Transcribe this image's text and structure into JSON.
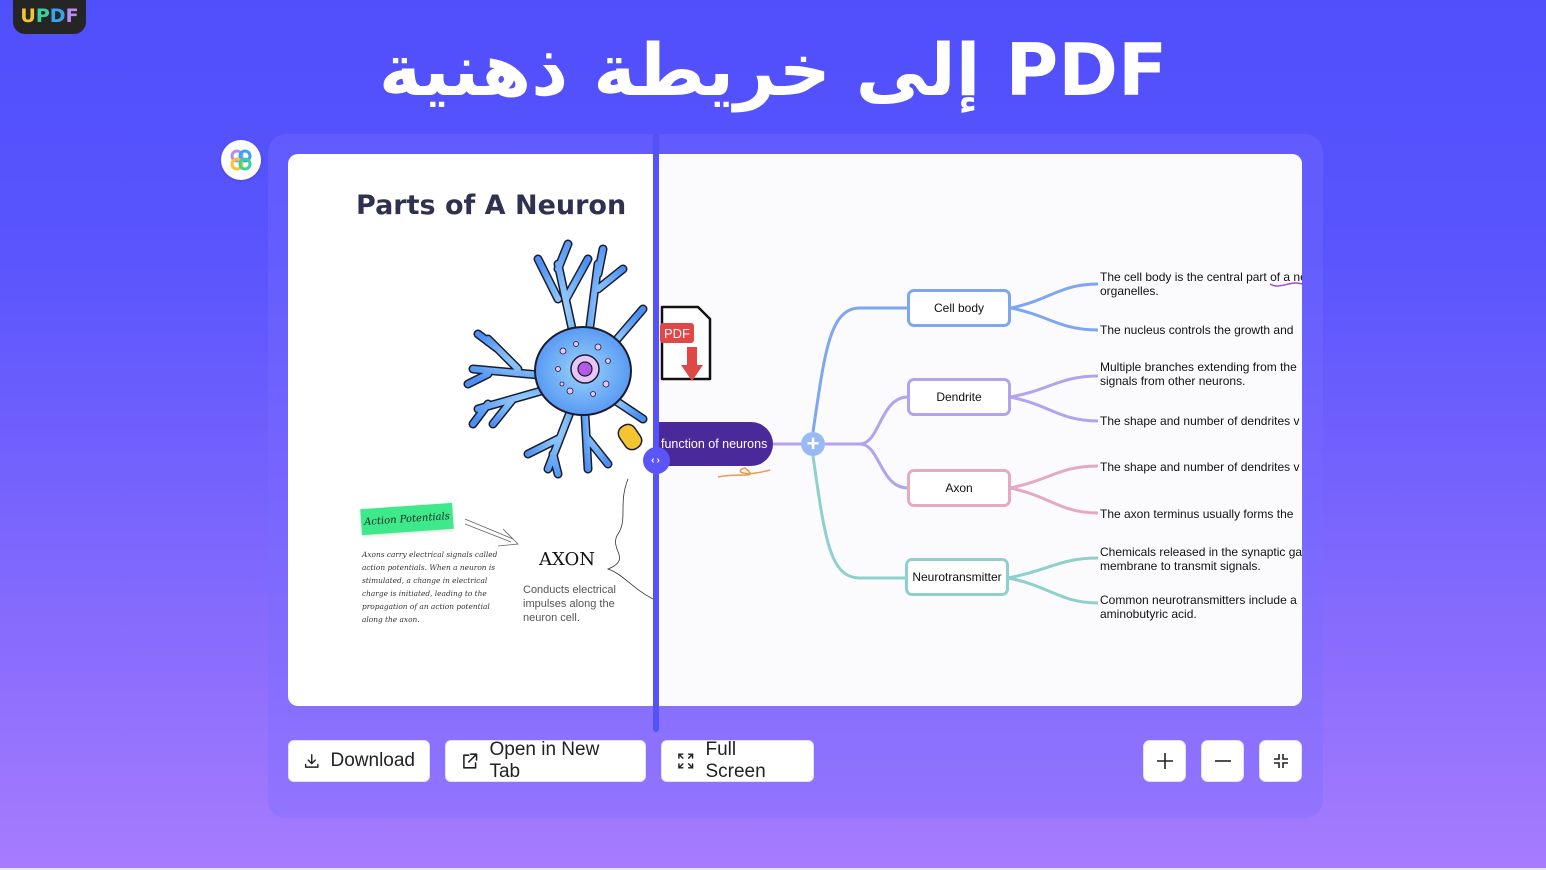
{
  "logo": {
    "letters": [
      "U",
      "P",
      "D",
      "F"
    ],
    "colors": [
      "#f4c431",
      "#36d39a",
      "#3aa3f0",
      "#b98cf6"
    ]
  },
  "hero": {
    "title": "PDF إلى خريطة ذهنية"
  },
  "badge": {
    "icon": "updf-ai-flower-icon"
  },
  "document": {
    "title": "Parts of A Neuron",
    "tag": "Action Potentials",
    "tag_color": "#3ee98b",
    "action_text": "Axons carry electrical signals called action potentials. When a neuron is stimulated, a change in electrical charge is initiated, leading to the propagation of an action potential along the axon.",
    "axon_title": "AXON",
    "axon_desc": "Conducts electrical impulses along the neuron cell."
  },
  "pdf_icon": {
    "label": "PDF",
    "color": "#e04848"
  },
  "mindmap": {
    "root": "function of neurons",
    "root_color": "#4a2a9a",
    "branches": [
      {
        "label": "Cell body",
        "color": "#7ea7ef",
        "leaves": [
          "The cell body is the central part of a neuron",
          "organelles.",
          "The nucleus controls the growth and"
        ]
      },
      {
        "label": "Dendrite",
        "color": "#b3a3ec",
        "leaves": [
          "Multiple branches extending from the",
          "signals from other neurons.",
          "The shape and number of dendrites v"
        ]
      },
      {
        "label": "Axon",
        "color": "#e6a9c4",
        "leaves": [
          "The shape and number of dendrites v",
          "The axon terminus usually forms the"
        ]
      },
      {
        "label": "Neurotransmitter",
        "color": "#8fd0cc",
        "leaves": [
          "Chemicals released in the synaptic ga",
          "membrane to transmit signals.",
          "Common neurotransmitters include a",
          "aminobutyric acid."
        ]
      }
    ]
  },
  "toolbar": {
    "download": "Download",
    "open_new_tab": "Open in New Tab",
    "full_screen": "Full Screen",
    "zoom_in_icon": "plus-icon",
    "zoom_out_icon": "minus-icon",
    "exit_fullscreen_icon": "collapse-icon"
  },
  "accent": "#5552f7"
}
